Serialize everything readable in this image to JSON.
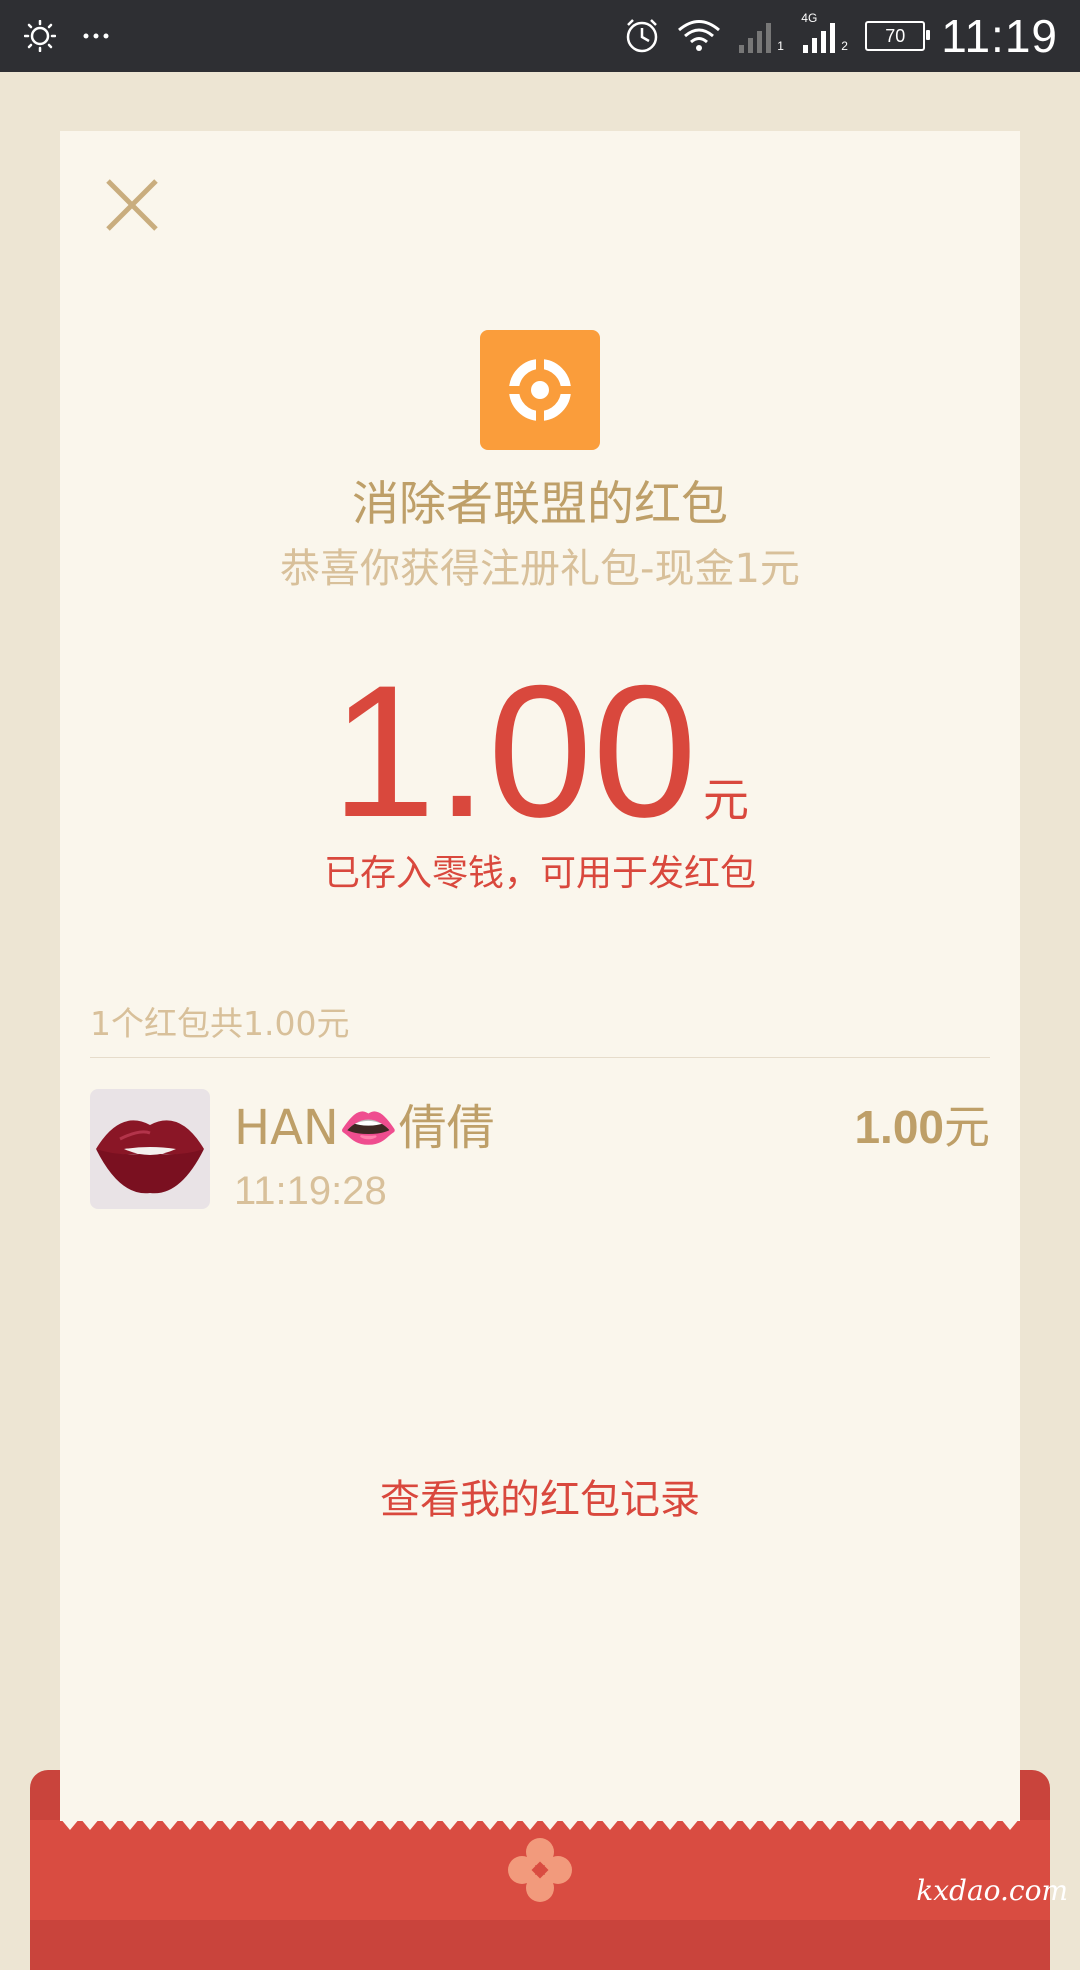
{
  "status_bar": {
    "time": "11:19",
    "battery": "70",
    "network_label": "4G",
    "sim1_label": "1",
    "sim2_label": "2",
    "icons": [
      "brightness-icon",
      "more-dots-icon",
      "alarm-icon",
      "wifi-icon",
      "signal-sim1-icon",
      "signal-sim2-icon",
      "battery-icon"
    ]
  },
  "card": {
    "sender_title": "消除者联盟的红包",
    "greeting": "恭喜你获得注册礼包-现金1元",
    "amount": "1.00",
    "amount_unit": "元",
    "saved_note": "已存入零钱，可用于发红包",
    "summary": "1个红包共1.00元",
    "receiver": {
      "name": "HAN👄倩倩",
      "time": "11:19:28",
      "amount": "1.00",
      "amount_unit": "元"
    },
    "history_link": "查看我的红包记录"
  },
  "watermark": "kxdao.com",
  "colors": {
    "status_bar": "#2e2f33",
    "background": "#ede5d3",
    "card": "#faf6ec",
    "gold_text": "#be9f68",
    "light_gold_text": "#d8c09a",
    "red_text": "#d9483d",
    "logo_orange": "#fa9d3b",
    "envelope_red": "#d94c41"
  }
}
